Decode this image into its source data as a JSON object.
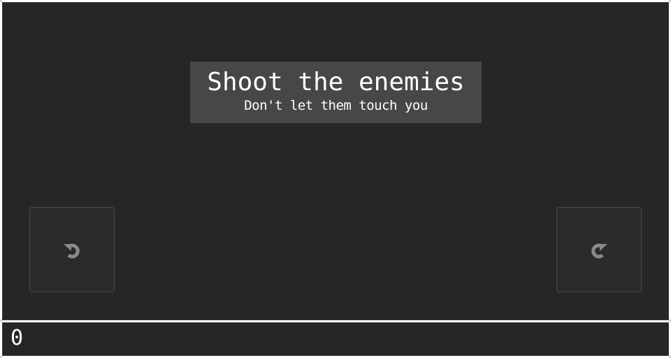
{
  "banner": {
    "title": "Shoot the enemies",
    "subtitle": "Don't let them touch you"
  },
  "controls": {
    "rotate_left_icon": "rotate-counterclockwise-icon",
    "rotate_right_icon": "rotate-clockwise-icon"
  },
  "hud": {
    "score": "0"
  },
  "colors": {
    "background": "#262626",
    "banner": "#474747",
    "button": "#2b2b2b",
    "icon": "#8a8a8a",
    "text": "#ffffff",
    "frame": "#ffffff"
  }
}
